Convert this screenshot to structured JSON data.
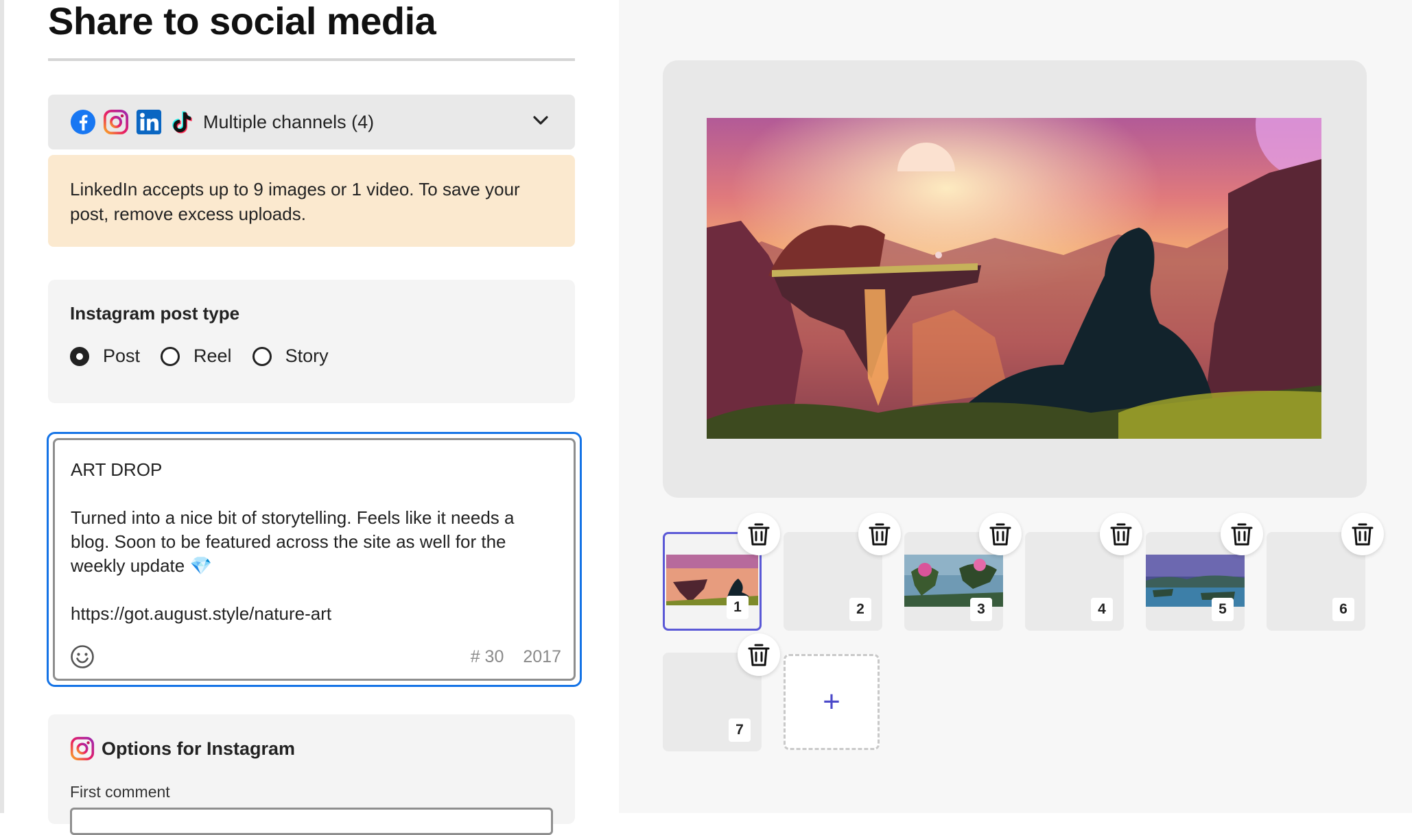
{
  "header": {
    "title": "Share to social media"
  },
  "channels": {
    "label": "Multiple channels (4)",
    "icons": [
      "facebook-icon",
      "instagram-icon",
      "linkedin-icon",
      "tiktok-icon"
    ]
  },
  "notice": {
    "text": "LinkedIn accepts up to 9 images or 1 video. To save your post, remove excess uploads."
  },
  "post_type": {
    "title": "Instagram post type",
    "options": [
      {
        "label": "Post",
        "checked": true
      },
      {
        "label": "Reel",
        "checked": false
      },
      {
        "label": "Story",
        "checked": false
      }
    ]
  },
  "caption": {
    "text": "ART DROP\n\nTurned into a nice bit of storytelling. Feels like it needs a blog. Soon to be featured across the site as well for the weekly update 💎\n\nhttps://got.august.style/nature-art",
    "hashtag_count": "# 30",
    "chars_remaining": "2017"
  },
  "instagram_options": {
    "title": "Options for Instagram",
    "first_comment_label": "First comment"
  },
  "media": {
    "thumbnails": [
      {
        "number": "1",
        "selected": true,
        "has_image": true
      },
      {
        "number": "2",
        "selected": false,
        "has_image": false
      },
      {
        "number": "3",
        "selected": false,
        "has_image": true
      },
      {
        "number": "4",
        "selected": false,
        "has_image": false
      },
      {
        "number": "5",
        "selected": false,
        "has_image": true
      },
      {
        "number": "6",
        "selected": false,
        "has_image": false
      },
      {
        "number": "7",
        "selected": false,
        "has_image": false
      }
    ]
  },
  "colors": {
    "accent_focus": "#1473e6",
    "selected_thumb": "#5a58d6",
    "notice_bg": "#fbe9cf",
    "add_plus": "#4b49c9"
  }
}
